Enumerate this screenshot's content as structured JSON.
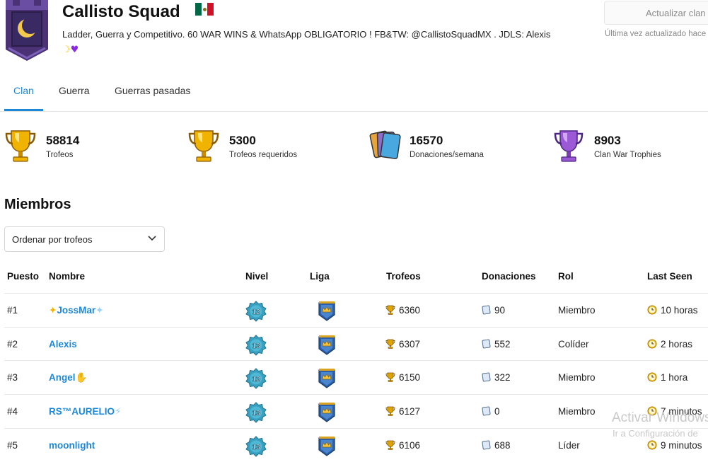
{
  "clan": {
    "name": "Callisto Squad",
    "description": "Ladder, Guerra y Competitivo. 60 WAR WINS & WhatsApp OBLIGATORIO ! FB&TW: @CallistoSquadMX . JDLS: Alexis",
    "desc_emoji_moon": "☽",
    "desc_emoji_heart": "♥"
  },
  "header": {
    "update_button": "Actualizar clan",
    "last_updated": "Última vez actualizado hace"
  },
  "tabs": [
    {
      "label": "Clan",
      "active": true
    },
    {
      "label": "Guerra",
      "active": false
    },
    {
      "label": "Guerras pasadas",
      "active": false
    }
  ],
  "stats": [
    {
      "value": "58814",
      "label": "Trofeos",
      "icon": "gold-trophy-icon"
    },
    {
      "value": "5300",
      "label": "Trofeos requeridos",
      "icon": "gold-trophy-icon"
    },
    {
      "value": "16570",
      "label": "Donaciones/semana",
      "icon": "cards-icon"
    },
    {
      "value": "8903",
      "label": "Clan War Trophies",
      "icon": "purple-trophy-icon"
    }
  ],
  "members": {
    "title": "Miembros",
    "sort_label": "Ordenar por trofeos",
    "columns": [
      "Puesto",
      "Nombre",
      "Nivel",
      "Liga",
      "Trofeos",
      "Donaciones",
      "Rol",
      "Last Seen"
    ],
    "rows": [
      {
        "rank": "#1",
        "name": "JossMar",
        "name_prefix": "✦",
        "name_suffix": "✦",
        "level": "12",
        "trophies": "6360",
        "donations": "90",
        "role": "Miembro",
        "last_seen": "10 horas"
      },
      {
        "rank": "#2",
        "name": "Alexis",
        "name_prefix": "",
        "name_suffix": "",
        "level": "13",
        "trophies": "6307",
        "donations": "552",
        "role": "Colíder",
        "last_seen": "2 horas"
      },
      {
        "rank": "#3",
        "name": "Angel",
        "name_prefix": "",
        "name_suffix": "✋",
        "level": "12",
        "trophies": "6150",
        "donations": "322",
        "role": "Miembro",
        "last_seen": "1 hora"
      },
      {
        "rank": "#4",
        "name": "RS™AURELIO",
        "name_prefix": "",
        "name_suffix": "⚡",
        "level": "13",
        "trophies": "6127",
        "donations": "0",
        "role": "Miembro",
        "last_seen": "7 minutos"
      },
      {
        "rank": "#5",
        "name": "moonlight",
        "name_prefix": "",
        "name_suffix": "",
        "level": "13",
        "trophies": "6106",
        "donations": "688",
        "role": "Líder",
        "last_seen": "9 minutos"
      }
    ]
  },
  "watermark": {
    "line1": "Activar Windows",
    "line2": "Ir a Configuración de"
  },
  "colors": {
    "accent": "#1e88d8",
    "badge_purple": "#5b3f8c",
    "level_teal": "#3aa0c0",
    "trophy_gold": "#e0a500"
  }
}
